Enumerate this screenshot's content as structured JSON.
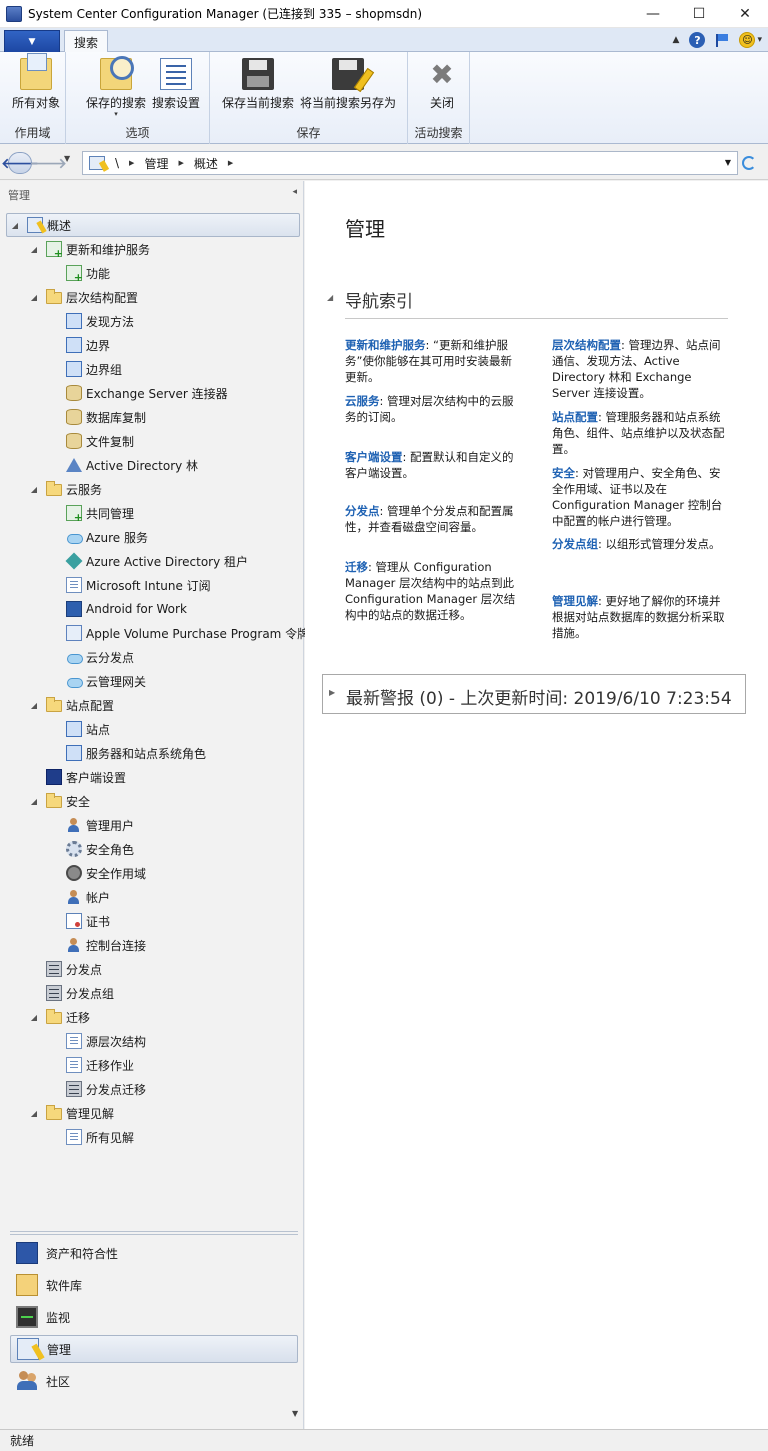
{
  "window": {
    "title": "System Center Configuration Manager (已连接到 335 – shopmsdn)",
    "min": "—",
    "max": "☐",
    "close": "✕"
  },
  "ribbon": {
    "file_menu_glyph": "▼",
    "tab": "搜索",
    "right_caret": "▲",
    "help_glyph": "?",
    "smile_glyph": "☺",
    "smile_caret": "▾",
    "groups": [
      {
        "label": "作用域",
        "buttons": [
          {
            "label": "所有对象",
            "icon": "all-objects-icon"
          }
        ]
      },
      {
        "label": "选项",
        "buttons": [
          {
            "label": "保存的搜索",
            "icon": "saved-searches-icon",
            "dropdown": "▾"
          },
          {
            "label": "搜索设置",
            "icon": "search-settings-icon"
          }
        ]
      },
      {
        "label": "保存",
        "buttons": [
          {
            "label": "保存当前搜索",
            "icon": "save-icon"
          },
          {
            "label": "将当前搜索另存为",
            "icon": "save-as-icon"
          }
        ]
      },
      {
        "label": "活动搜索",
        "buttons": [
          {
            "label": "关闭",
            "icon": "close-search-icon",
            "glyph": "✖"
          }
        ]
      }
    ]
  },
  "address": {
    "back": "🡐",
    "forward": "🡒",
    "history_dd": "▼",
    "root": "\\",
    "sep": "▶",
    "crumbs": [
      "管理",
      "概述"
    ],
    "dropdown": "▼"
  },
  "left_pane": {
    "header": "管理",
    "collapse": "◂",
    "tree": [
      {
        "label": "概述",
        "level": 0,
        "exp": "◢",
        "icon": "overview"
      },
      {
        "label": "更新和维护服务",
        "level": 1,
        "exp": "◢",
        "icon": "green"
      },
      {
        "label": "功能",
        "level": 2,
        "exp": "",
        "icon": "green"
      },
      {
        "label": "层次结构配置",
        "level": 1,
        "exp": "◢",
        "icon": "folder"
      },
      {
        "label": "发现方法",
        "level": 2,
        "exp": "",
        "icon": "blue"
      },
      {
        "label": "边界",
        "level": 2,
        "exp": "",
        "icon": "blue"
      },
      {
        "label": "边界组",
        "level": 2,
        "exp": "",
        "icon": "blue"
      },
      {
        "label": "Exchange Server 连接器",
        "level": 2,
        "exp": "",
        "icon": "db"
      },
      {
        "label": "数据库复制",
        "level": 2,
        "exp": "",
        "icon": "db"
      },
      {
        "label": "文件复制",
        "level": 2,
        "exp": "",
        "icon": "db"
      },
      {
        "label": "Active Directory 林",
        "level": 2,
        "exp": "",
        "icon": "tri"
      },
      {
        "label": "云服务",
        "level": 1,
        "exp": "◢",
        "icon": "folder"
      },
      {
        "label": "共同管理",
        "level": 2,
        "exp": "",
        "icon": "green"
      },
      {
        "label": "Azure 服务",
        "level": 2,
        "exp": "",
        "icon": "cloud"
      },
      {
        "label": "Azure Active Directory 租户",
        "level": 2,
        "exp": "",
        "icon": "wonder"
      },
      {
        "label": "Microsoft Intune 订阅",
        "level": 2,
        "exp": "",
        "icon": "doc"
      },
      {
        "label": "Android for Work",
        "level": 2,
        "exp": "",
        "icon": "android"
      },
      {
        "label": "Apple Volume Purchase Program 令牌",
        "level": 2,
        "exp": "",
        "icon": "apple"
      },
      {
        "label": "云分发点",
        "level": 2,
        "exp": "",
        "icon": "cloud"
      },
      {
        "label": "云管理网关",
        "level": 2,
        "exp": "",
        "icon": "cloud"
      },
      {
        "label": "站点配置",
        "level": 1,
        "exp": "◢",
        "icon": "folder"
      },
      {
        "label": "站点",
        "level": 2,
        "exp": "",
        "icon": "blue"
      },
      {
        "label": "服务器和站点系统角色",
        "level": 2,
        "exp": "",
        "icon": "blue"
      },
      {
        "label": "客户端设置",
        "level": 1,
        "exp": "",
        "icon": "monitor"
      },
      {
        "label": "安全",
        "level": 1,
        "exp": "◢",
        "icon": "folder"
      },
      {
        "label": "管理用户",
        "level": 2,
        "exp": "",
        "icon": "user"
      },
      {
        "label": "安全角色",
        "level": 2,
        "exp": "",
        "icon": "gear"
      },
      {
        "label": "安全作用域",
        "level": 2,
        "exp": "",
        "icon": "lock"
      },
      {
        "label": "帐户",
        "level": 2,
        "exp": "",
        "icon": "user"
      },
      {
        "label": "证书",
        "level": 2,
        "exp": "",
        "icon": "cert"
      },
      {
        "label": "控制台连接",
        "level": 2,
        "exp": "",
        "icon": "user"
      },
      {
        "label": "分发点",
        "level": 1,
        "exp": "",
        "icon": "server"
      },
      {
        "label": "分发点组",
        "level": 1,
        "exp": "",
        "icon": "server"
      },
      {
        "label": "迁移",
        "level": 1,
        "exp": "◢",
        "icon": "folder"
      },
      {
        "label": "源层次结构",
        "level": 2,
        "exp": "",
        "icon": "doc"
      },
      {
        "label": "迁移作业",
        "level": 2,
        "exp": "",
        "icon": "doc"
      },
      {
        "label": "分发点迁移",
        "level": 2,
        "exp": "",
        "icon": "server"
      },
      {
        "label": "管理见解",
        "level": 1,
        "exp": "◢",
        "icon": "folder"
      },
      {
        "label": "所有见解",
        "level": 2,
        "exp": "",
        "icon": "doc"
      }
    ],
    "workspaces": [
      {
        "label": "资产和符合性",
        "icon": "assets"
      },
      {
        "label": "软件库",
        "icon": "software"
      },
      {
        "label": "监视",
        "icon": "monitor"
      },
      {
        "label": "管理",
        "icon": "admin",
        "selected": true
      },
      {
        "label": "社区",
        "icon": "community"
      }
    ],
    "scroll_down": "▼"
  },
  "main": {
    "title": "管理",
    "section_title": "导航索引",
    "expander": "◢",
    "left_col": [
      {
        "link": "更新和维护服务",
        "text": ": “更新和维护服务”使你能够在其可用时安装最新更新。"
      },
      {
        "link": "云服务",
        "text": ": 管理对层次结构中的云服务的订阅。"
      },
      {
        "link": "客户端设置",
        "text": ": 配置默认和自定义的客户端设置。"
      },
      {
        "link": "分发点",
        "text": ": 管理单个分发点和配置属性，并查看磁盘空间容量。"
      },
      {
        "link": "迁移",
        "text": ": 管理从 Configuration Manager 层次结构中的站点到此 Configuration Manager 层次结构中的站点的数据迁移。"
      }
    ],
    "right_col": [
      {
        "link": "层次结构配置",
        "text": ": 管理边界、站点间通信、发现方法、Active Directory 林和 Exchange Server 连接设置。"
      },
      {
        "link": "站点配置",
        "text": ": 管理服务器和站点系统角色、组件、站点维护以及状态配置。"
      },
      {
        "link": "安全",
        "text": ": 对管理用户、安全角色、安全作用域、证书以及在 Configuration Manager 控制台中配置的帐户进行管理。"
      },
      {
        "link": "分发点组",
        "text": ": 以组形式管理分发点。"
      },
      {
        "link": "管理见解",
        "text": ": 更好地了解你的环境并根据对站点数据库的数据分析采取措施。"
      }
    ],
    "alerts_expander": "▶",
    "alerts": "最新警报 (0) - 上次更新时间: 2019/6/10 7:23:54"
  },
  "status": "就绪"
}
